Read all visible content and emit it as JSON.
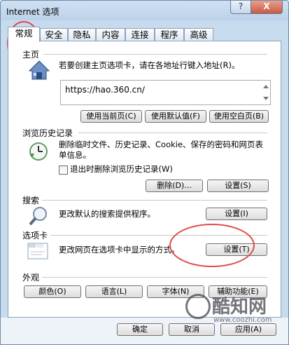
{
  "window": {
    "title": "Internet 选项",
    "help": "?",
    "close": "X"
  },
  "tabs": [
    "常规",
    "安全",
    "隐私",
    "内容",
    "连接",
    "程序",
    "高级"
  ],
  "home": {
    "label": "主页",
    "description": "若要创建主页选项卡，请在各地址行键入地址(R)。",
    "url": "https://hao.360.cn/",
    "buttons": [
      "使用当前页(C)",
      "使用默认值(F)",
      "使用空白页(B)"
    ]
  },
  "history": {
    "label": "浏览历史记录",
    "description": "删除临时文件、历史记录、Cookie、保存的密码和网页表单信息。",
    "checkbox_label": "退出时删除浏览历史记录(W)",
    "checkbox_checked": false,
    "delete_button": "删除(D)...",
    "settings_button": "设置(S)"
  },
  "search": {
    "label": "搜索",
    "description": "更改默认的搜索提供程序。",
    "settings_button": "设置(I)"
  },
  "tabs_section": {
    "label": "选项卡",
    "description": "更改网页在选项卡中显示的方式。",
    "settings_button": "设置(T)"
  },
  "appearance": {
    "label": "外观",
    "buttons": [
      "颜色(O)",
      "语言(L)",
      "字体(N)",
      "辅助功能(E)"
    ]
  },
  "footer": {
    "ok": "确定",
    "cancel": "取消",
    "apply": "应用(A)"
  },
  "watermark": {
    "brand": "酷知网",
    "url": "www.coozhi.com"
  },
  "colors": {
    "annotation_red": "#e04848",
    "title_bg": "#bcd2ea"
  }
}
